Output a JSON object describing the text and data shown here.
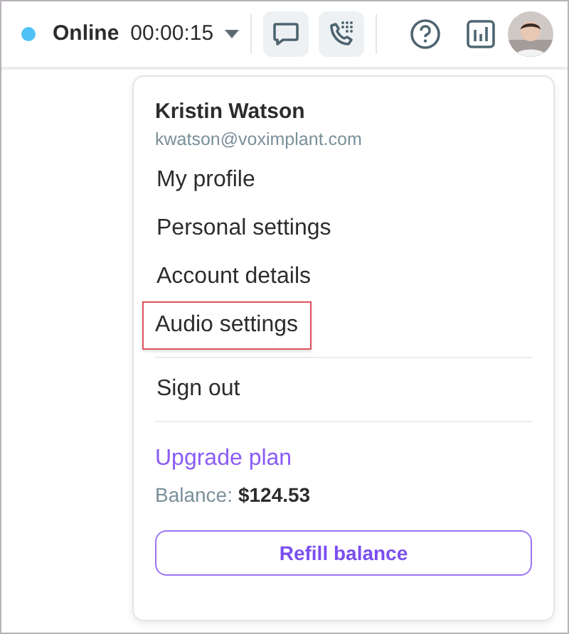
{
  "status": {
    "label": "Online",
    "timer": "00:00:15",
    "color": "#4fc3f7"
  },
  "toolbar": [
    {
      "kind": "chat",
      "filled": true
    },
    {
      "kind": "dialpad",
      "filled": true
    },
    {
      "kind": "help",
      "filled": false
    },
    {
      "kind": "stats",
      "filled": false
    }
  ],
  "menu": {
    "name": "Kristin Watson",
    "email": "kwatson@voximplant.com",
    "items": [
      {
        "label": "My profile",
        "highlighted": false
      },
      {
        "label": "Personal settings",
        "highlighted": false
      },
      {
        "label": "Account details",
        "highlighted": false
      },
      {
        "label": "Audio settings",
        "highlighted": true
      }
    ],
    "sign_out": "Sign out",
    "upgrade": "Upgrade plan",
    "balance_label": "Balance:",
    "balance_value": "$124.53",
    "refill_button": "Refill balance"
  }
}
